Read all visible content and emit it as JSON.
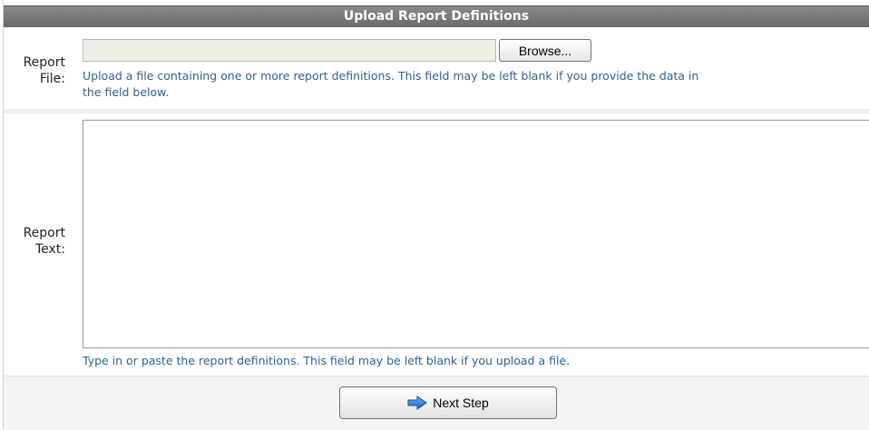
{
  "panel": {
    "title": "Upload Report Definitions"
  },
  "report_file": {
    "label_line1": "Report",
    "label_line2": "File:",
    "value": "",
    "browse_label": "Browse...",
    "help_line1": "Upload a file containing one or more report definitions. This field may be left blank if you provide the data in",
    "help_line2": "the field below."
  },
  "report_text": {
    "label_line1": "Report",
    "label_line2": "Text:",
    "value": "",
    "help": "Type in or paste the report definitions. This field may be left blank if you upload a file."
  },
  "footer": {
    "next_label": "Next Step",
    "next_icon": "right-arrow-icon",
    "accent_color": "#2a6496"
  }
}
